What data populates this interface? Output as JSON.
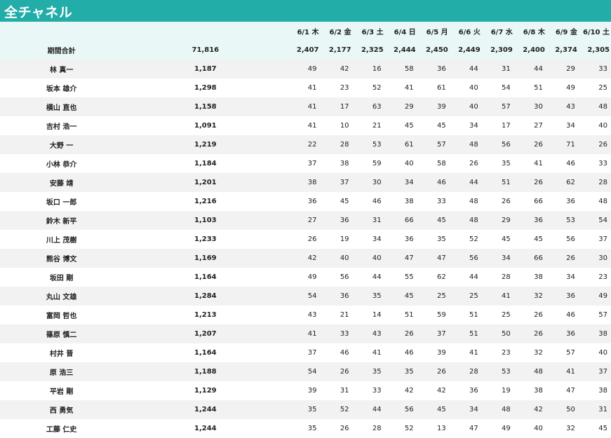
{
  "title": "全チャネル",
  "dates": [
    "6/1 木",
    "6/2 金",
    "6/3 土",
    "6/4 日",
    "6/5 月",
    "6/6 火",
    "6/7 水",
    "6/8 木",
    "6/9 金",
    "6/10 土"
  ],
  "total_label": "期間合計",
  "grand_total": "71,816",
  "daily_totals": [
    "2,407",
    "2,177",
    "2,325",
    "2,444",
    "2,450",
    "2,449",
    "2,309",
    "2,400",
    "2,374",
    "2,305"
  ],
  "rows": [
    {
      "name": "林 真一",
      "total": "1,187",
      "values": [
        "49",
        "42",
        "16",
        "58",
        "36",
        "44",
        "31",
        "44",
        "29",
        "33"
      ]
    },
    {
      "name": "坂本 雄介",
      "total": "1,298",
      "values": [
        "41",
        "23",
        "52",
        "41",
        "61",
        "40",
        "54",
        "51",
        "49",
        "25"
      ]
    },
    {
      "name": "横山 直也",
      "total": "1,158",
      "values": [
        "41",
        "17",
        "63",
        "29",
        "39",
        "40",
        "57",
        "30",
        "43",
        "48"
      ]
    },
    {
      "name": "吉村 浩一",
      "total": "1,091",
      "values": [
        "41",
        "10",
        "21",
        "45",
        "45",
        "34",
        "17",
        "27",
        "34",
        "40"
      ]
    },
    {
      "name": "大野 一",
      "total": "1,219",
      "values": [
        "22",
        "28",
        "53",
        "61",
        "57",
        "48",
        "56",
        "26",
        "71",
        "26"
      ]
    },
    {
      "name": "小林 恭介",
      "total": "1,184",
      "values": [
        "37",
        "38",
        "59",
        "40",
        "58",
        "26",
        "35",
        "41",
        "46",
        "33"
      ]
    },
    {
      "name": "安藤 靖",
      "total": "1,201",
      "values": [
        "38",
        "37",
        "30",
        "34",
        "46",
        "44",
        "51",
        "26",
        "62",
        "28"
      ]
    },
    {
      "name": "坂口 一郎",
      "total": "1,216",
      "values": [
        "36",
        "45",
        "46",
        "38",
        "33",
        "48",
        "26",
        "66",
        "36",
        "48"
      ]
    },
    {
      "name": "鈴木 新平",
      "total": "1,103",
      "values": [
        "27",
        "36",
        "31",
        "66",
        "45",
        "48",
        "29",
        "36",
        "53",
        "54"
      ]
    },
    {
      "name": "川上 茂樹",
      "total": "1,233",
      "values": [
        "26",
        "19",
        "34",
        "36",
        "35",
        "52",
        "45",
        "45",
        "56",
        "37"
      ]
    },
    {
      "name": "熊谷 博文",
      "total": "1,169",
      "values": [
        "42",
        "40",
        "40",
        "47",
        "47",
        "56",
        "34",
        "66",
        "26",
        "30"
      ]
    },
    {
      "name": "坂田 剛",
      "total": "1,164",
      "values": [
        "49",
        "56",
        "44",
        "55",
        "62",
        "44",
        "28",
        "38",
        "34",
        "23"
      ]
    },
    {
      "name": "丸山 文雄",
      "total": "1,284",
      "values": [
        "54",
        "36",
        "35",
        "45",
        "25",
        "25",
        "41",
        "32",
        "36",
        "49"
      ]
    },
    {
      "name": "富岡 哲也",
      "total": "1,213",
      "values": [
        "43",
        "21",
        "14",
        "51",
        "59",
        "51",
        "25",
        "26",
        "46",
        "57"
      ]
    },
    {
      "name": "篠原 慎二",
      "total": "1,207",
      "values": [
        "41",
        "33",
        "43",
        "26",
        "37",
        "51",
        "50",
        "26",
        "36",
        "38"
      ]
    },
    {
      "name": "村井 晋",
      "total": "1,164",
      "values": [
        "37",
        "46",
        "41",
        "46",
        "39",
        "41",
        "23",
        "32",
        "57",
        "40"
      ]
    },
    {
      "name": "原 浩三",
      "total": "1,188",
      "values": [
        "54",
        "26",
        "35",
        "35",
        "26",
        "28",
        "53",
        "48",
        "41",
        "37"
      ]
    },
    {
      "name": "平岩 剛",
      "total": "1,129",
      "values": [
        "39",
        "31",
        "33",
        "42",
        "42",
        "36",
        "19",
        "38",
        "47",
        "38"
      ]
    },
    {
      "name": "西 勇気",
      "total": "1,244",
      "values": [
        "35",
        "52",
        "44",
        "56",
        "45",
        "34",
        "48",
        "42",
        "50",
        "31"
      ]
    },
    {
      "name": "工藤 仁史",
      "total": "1,244",
      "values": [
        "35",
        "26",
        "28",
        "52",
        "13",
        "47",
        "49",
        "40",
        "32",
        "45"
      ]
    }
  ]
}
